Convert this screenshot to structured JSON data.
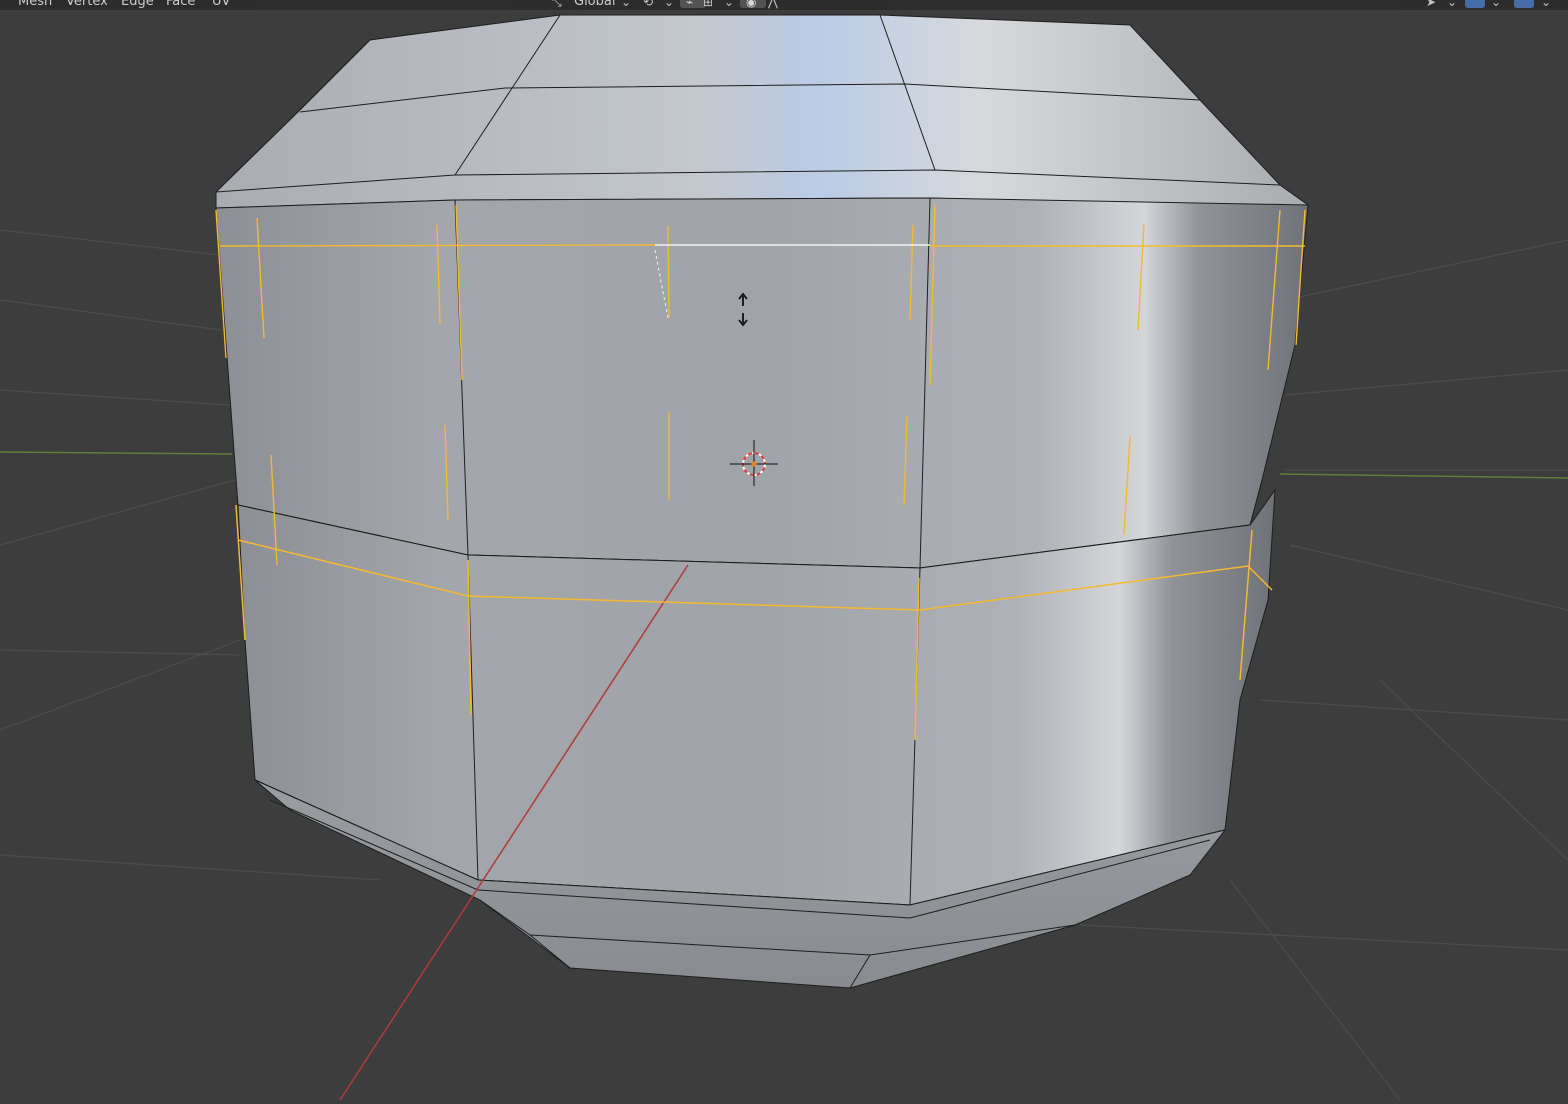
{
  "header": {
    "menus": [
      "Mesh",
      "Vertex",
      "Edge",
      "Face",
      "UV"
    ],
    "transform_orientation": "Global",
    "icons": [
      "transform-orientation-icon",
      "pivot-point-icon",
      "snap-icon",
      "snap-increment-icon",
      "proportional-editing-icon",
      "proportional-falloff-icon",
      "select-tool-icon",
      "edge-select-icon",
      "overlay-icon"
    ]
  },
  "viewport": {
    "mode": "Edit Mode",
    "cursor_icon": "3d-cursor-icon",
    "transform_cursor_icon": "move-vertical-cursor-icon"
  },
  "colors": {
    "background": "#3d3d3d",
    "header": "#2b2b2b",
    "selected_edge": "#f5b931",
    "x_axis": "#b03a3a",
    "y_axis": "#5e7f3a",
    "mesh_light": "#c9ccd2",
    "mesh_dark": "#7a7d82"
  }
}
